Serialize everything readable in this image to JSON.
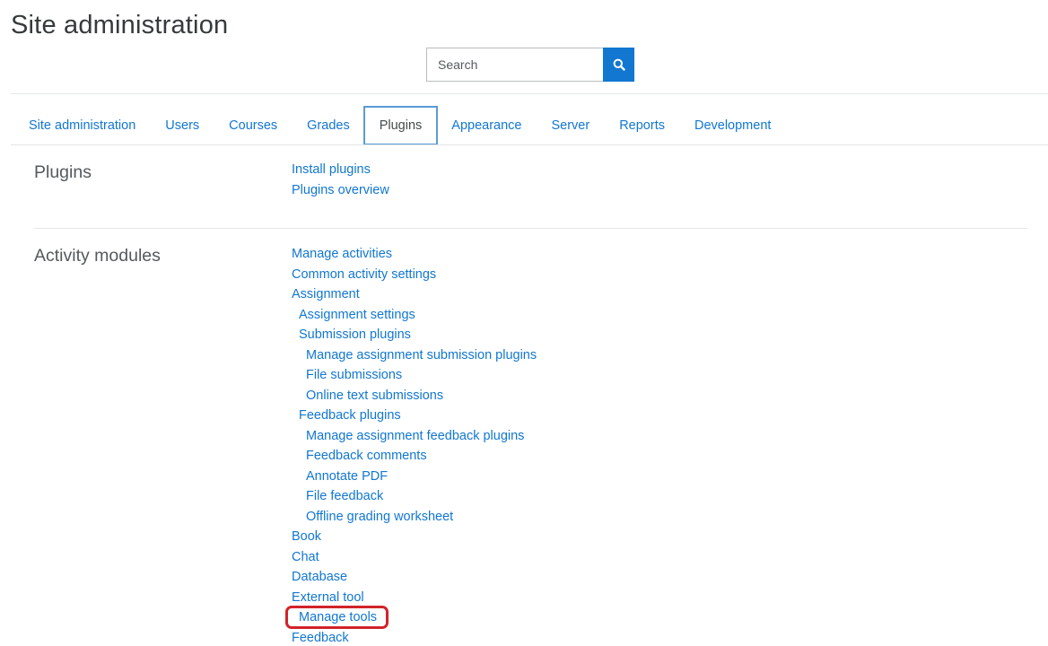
{
  "page": {
    "title": "Site administration"
  },
  "search": {
    "placeholder": "Search",
    "button_icon": "search-icon",
    "button_color": "#1177d1"
  },
  "tabs": [
    {
      "label": "Site administration",
      "active": false
    },
    {
      "label": "Users",
      "active": false
    },
    {
      "label": "Courses",
      "active": false
    },
    {
      "label": "Grades",
      "active": false
    },
    {
      "label": "Plugins",
      "active": true
    },
    {
      "label": "Appearance",
      "active": false
    },
    {
      "label": "Server",
      "active": false
    },
    {
      "label": "Reports",
      "active": false
    },
    {
      "label": "Development",
      "active": false
    }
  ],
  "sections": {
    "plugins": {
      "heading": "Plugins",
      "links": [
        "Install plugins",
        "Plugins overview"
      ]
    },
    "activity_modules": {
      "heading": "Activity modules",
      "links": [
        {
          "label": "Manage activities",
          "level": 0
        },
        {
          "label": "Common activity settings",
          "level": 0
        },
        {
          "label": "Assignment",
          "level": 0
        },
        {
          "label": "Assignment settings",
          "level": 1
        },
        {
          "label": "Submission plugins",
          "level": 1
        },
        {
          "label": "Manage assignment submission plugins",
          "level": 2
        },
        {
          "label": "File submissions",
          "level": 2
        },
        {
          "label": "Online text submissions",
          "level": 2
        },
        {
          "label": "Feedback plugins",
          "level": 1
        },
        {
          "label": "Manage assignment feedback plugins",
          "level": 2
        },
        {
          "label": "Feedback comments",
          "level": 2
        },
        {
          "label": "Annotate PDF",
          "level": 2
        },
        {
          "label": "File feedback",
          "level": 2
        },
        {
          "label": "Offline grading worksheet",
          "level": 2
        },
        {
          "label": "Book",
          "level": 0
        },
        {
          "label": "Chat",
          "level": 0
        },
        {
          "label": "Database",
          "level": 0
        },
        {
          "label": "External tool",
          "level": 0
        },
        {
          "label": "Manage tools",
          "level": 1,
          "highlighted": true
        },
        {
          "label": "Feedback",
          "level": 0
        }
      ]
    }
  },
  "colors": {
    "link": "#1177d1",
    "active_tab_border": "#5b9bd5",
    "highlight_annotation": "#d2232a"
  }
}
